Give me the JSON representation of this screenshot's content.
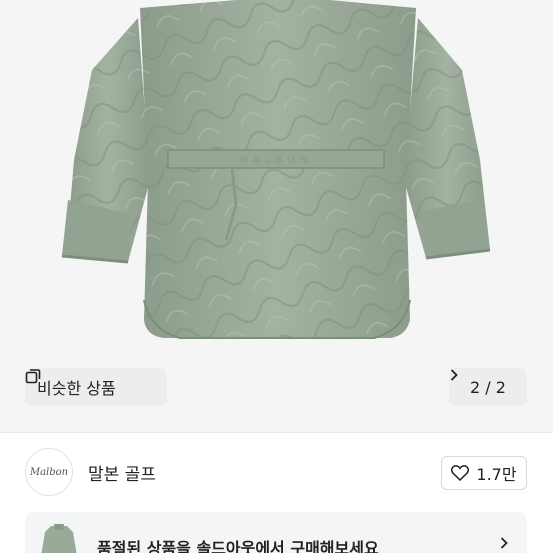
{
  "photo": {
    "similar_label": "비슷한 상품",
    "pager_text": "2 / 2",
    "belt_text": "MALBON"
  },
  "shop": {
    "avatar_text": "Malbon",
    "name": "말본 골프",
    "like_count": "1.7만"
  },
  "banner": {
    "text": "품절된 상품을 솔드아웃에서 구매해보세요"
  },
  "colors": {
    "jacket": "#9aaa99",
    "background": "#f5f5f5",
    "text": "#222222"
  }
}
